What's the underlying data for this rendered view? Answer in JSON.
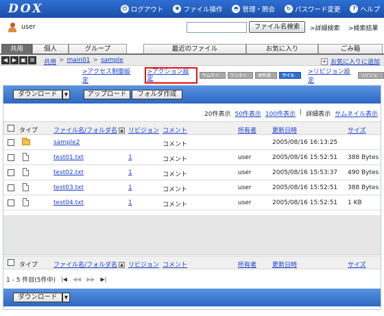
{
  "header": {
    "logo": "DOX",
    "nav": [
      {
        "label": "ログアウト",
        "icon": "power-icon"
      },
      {
        "label": "ファイル操作",
        "icon": "settings-icon"
      },
      {
        "label": "管理・照会",
        "icon": "admin-icon"
      },
      {
        "label": "パスワード変更",
        "icon": "refresh-icon"
      },
      {
        "label": "ヘルプ",
        "icon": "help-icon"
      }
    ]
  },
  "user": {
    "name": "user"
  },
  "search": {
    "button": "ファイル名検索",
    "advanced": ">詳細検索",
    "results": ">検索結果"
  },
  "tabs": [
    "共用",
    "個人",
    "グループ",
    "最近のファイル",
    "お気に入り",
    "ごみ箱"
  ],
  "breadcrumb": {
    "items": [
      "共用",
      "main01",
      "sample"
    ],
    "separator": ">",
    "favorite": "お気に入りに追加"
  },
  "settings": {
    "access": ">アクセス制御設定",
    "action": ">アクション設定",
    "chips": [
      "サムネイル",
      "ワンタイム",
      "更新通知",
      "ウイルス"
    ],
    "revision": ">リビジョン設定",
    "chip_revision": "リビジョン"
  },
  "toolbar": {
    "download": "ダウンロード",
    "upload": "アップロード",
    "create_folder": "フォルダ作成"
  },
  "view": {
    "count20": "20件表示",
    "count50": "50件表示",
    "count100": "100件表示",
    "bar": "|",
    "detail": "詳細表示",
    "thumbnail": "サムネイル表示"
  },
  "columns": {
    "type": "タイプ",
    "name": "ファイル名/フォルダ名",
    "revision": "リビジョン",
    "comment": "コメント",
    "owner": "所有者",
    "updated": "更新日時",
    "size": "サイズ"
  },
  "rows": [
    {
      "type": "folder",
      "name": "sample2",
      "revision": "",
      "comment": "コメント",
      "owner": "",
      "updated": "2005/08/16 16:13:25",
      "size": ""
    },
    {
      "type": "file",
      "name": "test01.txt",
      "revision": "1",
      "comment": "コメント",
      "owner": "user",
      "updated": "2005/08/16 15:52:51",
      "size": "388 Bytes"
    },
    {
      "type": "file",
      "name": "test02.txt",
      "revision": "1",
      "comment": "コメント",
      "owner": "user",
      "updated": "2005/08/16 15:53:37",
      "size": "490 Bytes"
    },
    {
      "type": "file",
      "name": "test03.txt",
      "revision": "1",
      "comment": "コメント",
      "owner": "user",
      "updated": "2005/08/16 15:52:51",
      "size": "388 Bytes"
    },
    {
      "type": "file",
      "name": "test04.txt",
      "revision": "1",
      "comment": "コメント",
      "owner": "user",
      "updated": "2005/08/16 15:52:51",
      "size": "1 KB"
    }
  ],
  "pager": {
    "summary": "1 - 5 件目(5件中)",
    "first": "|◀",
    "prev": "◀◀",
    "next": "▶▶",
    "last": "▶|"
  }
}
